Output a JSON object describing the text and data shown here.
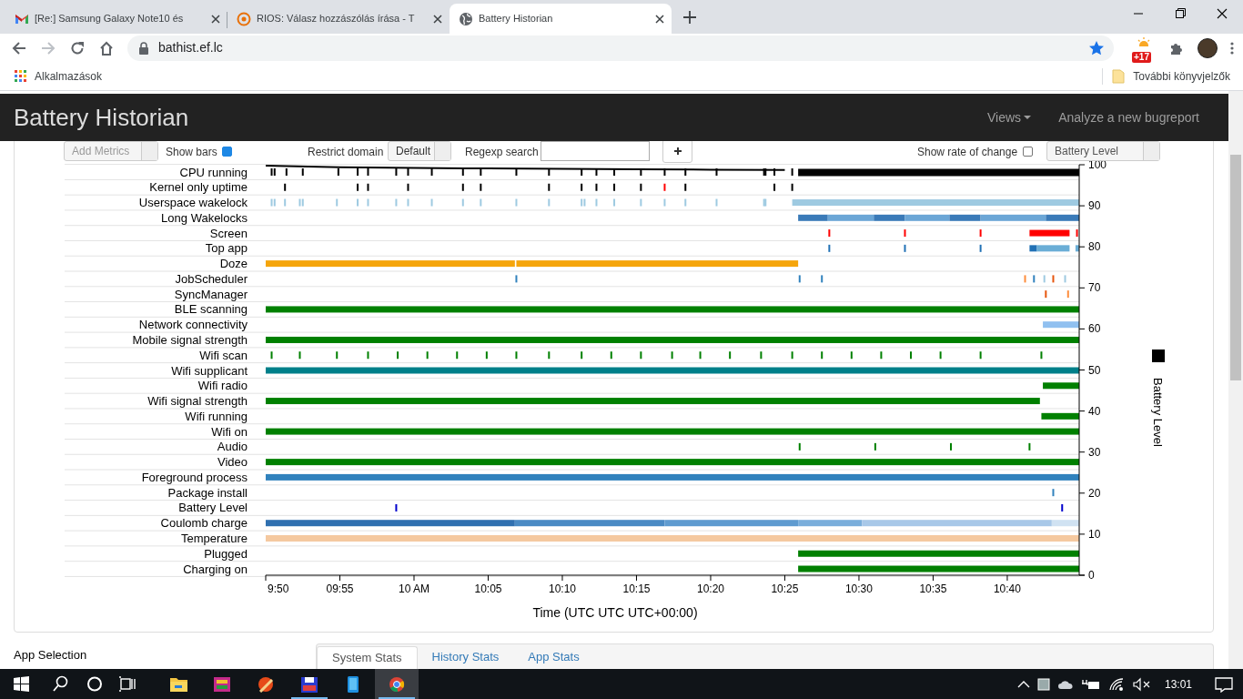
{
  "browser": {
    "tabs": [
      {
        "kind": "mail",
        "title": "[Re:] Samsung Galaxy Note10 és",
        "selected": false
      },
      {
        "kind": "forum",
        "title": "RIOS: Válasz hozzászólás írása - T",
        "selected": false
      },
      {
        "kind": "globe",
        "title": "Battery Historian",
        "selected": true
      }
    ],
    "address": "bathist.ef.lc",
    "extension_badge": "+17",
    "bookmarks": {
      "apps": "Alkalmazások",
      "other": "További könyvjelzők"
    }
  },
  "header": {
    "title": "Battery Historian",
    "menu": [
      {
        "label": "Views",
        "dropdown": true
      },
      {
        "label": "Analyze a new bugreport",
        "dropdown": false
      }
    ]
  },
  "controls": {
    "add_metrics": "Add Metrics",
    "show_bars": {
      "label": "Show bars",
      "checked": true
    },
    "restrict_domain": {
      "label": "Restrict domain",
      "value": "Default"
    },
    "regexp_search": {
      "label": "Regexp search"
    },
    "show_rate_of_change": {
      "label": "Show rate of change",
      "checked": false
    },
    "metric": "Battery Level"
  },
  "timeline": {
    "rows": [
      {
        "label": "CPU running",
        "color": "#000000"
      },
      {
        "label": "Kernel only uptime",
        "color": "#000000",
        "accents": [
          {
            "color": "#ff0000"
          }
        ]
      },
      {
        "label": "Userspace wakelock",
        "color": "#9ecae1"
      },
      {
        "label": "Long Wakelocks",
        "color": "#6ba6d6",
        "accents": [
          {
            "color": "#3a7ab8"
          }
        ]
      },
      {
        "label": "Screen",
        "color": "#ff0000"
      },
      {
        "label": "Top app",
        "color": "#6baed6",
        "accents": [
          {
            "color": "#2171b5"
          }
        ]
      },
      {
        "label": "Doze",
        "color": "#f5a50b"
      },
      {
        "label": "JobScheduler",
        "color": "#3182bd",
        "accents": [
          {
            "color": "#fd8d3c"
          },
          {
            "color": "#9ecae1"
          },
          {
            "color": "#e6550d"
          }
        ]
      },
      {
        "label": "SyncManager",
        "color": "#fd8d3c",
        "accents": [
          {
            "color": "#e6550d"
          }
        ]
      },
      {
        "label": "BLE scanning",
        "color": "#008000"
      },
      {
        "label": "Network connectivity",
        "color": "#90c0f0"
      },
      {
        "label": "Mobile signal strength",
        "color": "#008000"
      },
      {
        "label": "Wifi scan",
        "color": "#008000"
      },
      {
        "label": "Wifi supplicant",
        "color": "#00808a"
      },
      {
        "label": "Wifi radio",
        "color": "#008000"
      },
      {
        "label": "Wifi signal strength",
        "color": "#008000"
      },
      {
        "label": "Wifi running",
        "color": "#008000"
      },
      {
        "label": "Wifi on",
        "color": "#008000"
      },
      {
        "label": "Audio",
        "color": "#008000"
      },
      {
        "label": "Video",
        "color": "#008000"
      },
      {
        "label": "Foreground process",
        "color": "#3182bd"
      },
      {
        "label": "Package install",
        "color": "#3182bd"
      },
      {
        "label": "Battery Level",
        "color": "#0000cc"
      },
      {
        "label": "Coulomb charge",
        "color": "#3070b0",
        "accents": [
          {
            "color": "#4a8ac4"
          },
          {
            "color": "#5f9bd0"
          },
          {
            "color": "#7aaedb"
          },
          {
            "color": "#a8c8e8"
          },
          {
            "color": "#d0e2f2"
          }
        ]
      },
      {
        "label": "Temperature",
        "color": "#f5c9a0"
      },
      {
        "label": "Plugged",
        "color": "#008000"
      },
      {
        "label": "Charging on",
        "color": "#008000"
      }
    ],
    "chart_data": {
      "type": "line",
      "xlabel": "Time (UTC UTC UTC+00:00)",
      "ylim": [
        0,
        100
      ],
      "categories": [
        "9:50",
        "09:55",
        "10 AM",
        "10:05",
        "10:10",
        "10:15",
        "10:20",
        "10:25",
        "10:30",
        "10:35",
        "10:40"
      ],
      "yticks": [
        0,
        10,
        20,
        30,
        40,
        50,
        60,
        70,
        80,
        90,
        100
      ],
      "series": [
        {
          "name": "Battery Level",
          "color": "#000000",
          "values": [
            99.8,
            99.4,
            99.2,
            99.1,
            99.0,
            98.9,
            98.8,
            98.7,
            null,
            null,
            null
          ]
        }
      ]
    }
  },
  "app_selection": "App Selection",
  "stats_tabs": [
    {
      "label": "System Stats",
      "selected": true
    },
    {
      "label": "History Stats",
      "selected": false
    },
    {
      "label": "App Stats",
      "selected": false
    }
  ],
  "taskbar": {
    "apps": [
      {
        "kind": "folder",
        "running": false,
        "selected": false
      },
      {
        "kind": "palette",
        "running": false,
        "selected": false
      },
      {
        "kind": "brush",
        "running": false,
        "selected": false
      },
      {
        "kind": "disk",
        "running": true,
        "selected": false
      },
      {
        "kind": "phone",
        "running": false,
        "selected": false
      },
      {
        "kind": "chrome",
        "running": true,
        "selected": true
      }
    ],
    "clock": "13:01"
  }
}
